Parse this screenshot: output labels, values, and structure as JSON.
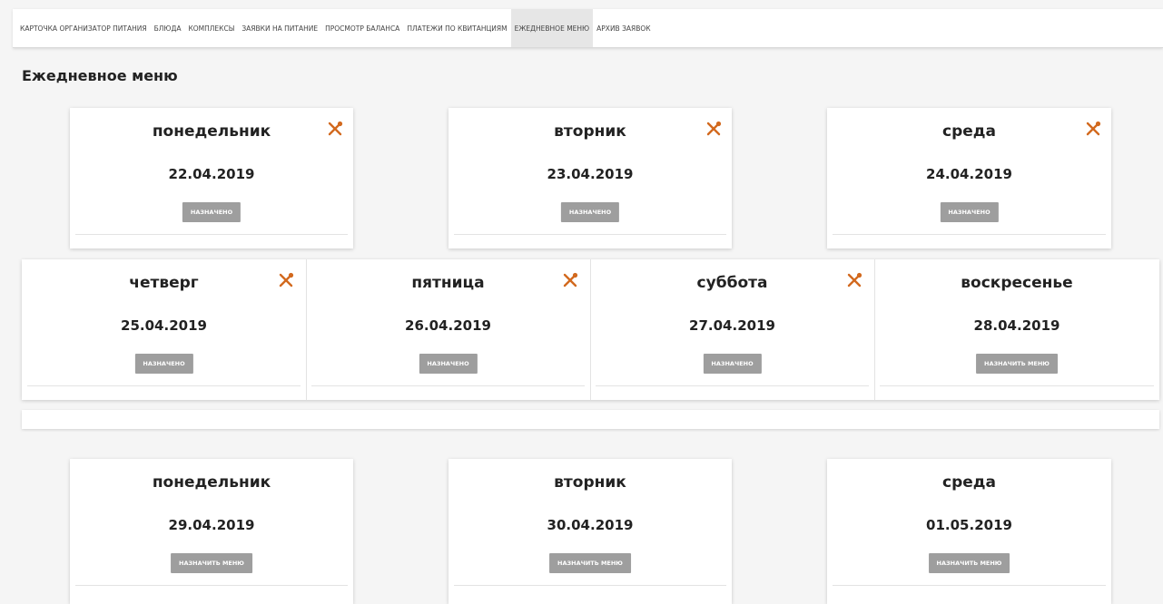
{
  "nav": {
    "tabs": [
      {
        "label": "КАРТОЧКА ОРГАНИЗАТОР ПИТАНИЯ"
      },
      {
        "label": "БЛЮДА"
      },
      {
        "label": "КОМПЛЕКСЫ"
      },
      {
        "label": "ЗАЯВКИ НА ПИТАНИЕ"
      },
      {
        "label": "ПРОСМОТР БАЛАНСА"
      },
      {
        "label": "ПЛАТЕЖИ ПО КВИТАНЦИЯМ"
      },
      {
        "label": "ЕЖЕДНЕВНОЕ МЕНЮ",
        "active": true
      },
      {
        "label": "АРХИВ ЗАЯВОК"
      }
    ]
  },
  "page": {
    "title": "Ежедневное меню"
  },
  "colors": {
    "icon": "#d2691e",
    "button": "#9e9e9e"
  },
  "week1": {
    "cards": [
      {
        "day": "понедельник",
        "date": "22.04.2019",
        "button": "НАЗНАЧЕНО",
        "icon": "fork-spoon-icon"
      },
      {
        "day": "вторник",
        "date": "23.04.2019",
        "button": "НАЗНАЧЕНО",
        "icon": "fork-spoon-icon"
      },
      {
        "day": "среда",
        "date": "24.04.2019",
        "button": "НАЗНАЧЕНО",
        "icon": "fork-spoon-icon"
      },
      {
        "day": "четверг",
        "date": "25.04.2019",
        "button": "НАЗНАЧЕНО",
        "icon": "fork-spoon-icon"
      },
      {
        "day": "пятница",
        "date": "26.04.2019",
        "button": "НАЗНАЧЕНО",
        "icon": "fork-spoon-icon"
      },
      {
        "day": "суббота",
        "date": "27.04.2019",
        "button": "НАЗНАЧЕНО",
        "icon": "fork-spoon-icon"
      },
      {
        "day": "воскресенье",
        "date": "28.04.2019",
        "button": "НАЗНАЧИТЬ МЕНЮ"
      }
    ]
  },
  "week2": {
    "cards": [
      {
        "day": "понедельник",
        "date": "29.04.2019",
        "button": "НАЗНАЧИТЬ МЕНЮ"
      },
      {
        "day": "вторник",
        "date": "30.04.2019",
        "button": "НАЗНАЧИТЬ МЕНЮ"
      },
      {
        "day": "среда",
        "date": "01.05.2019",
        "button": "НАЗНАЧИТЬ МЕНЮ"
      }
    ]
  }
}
